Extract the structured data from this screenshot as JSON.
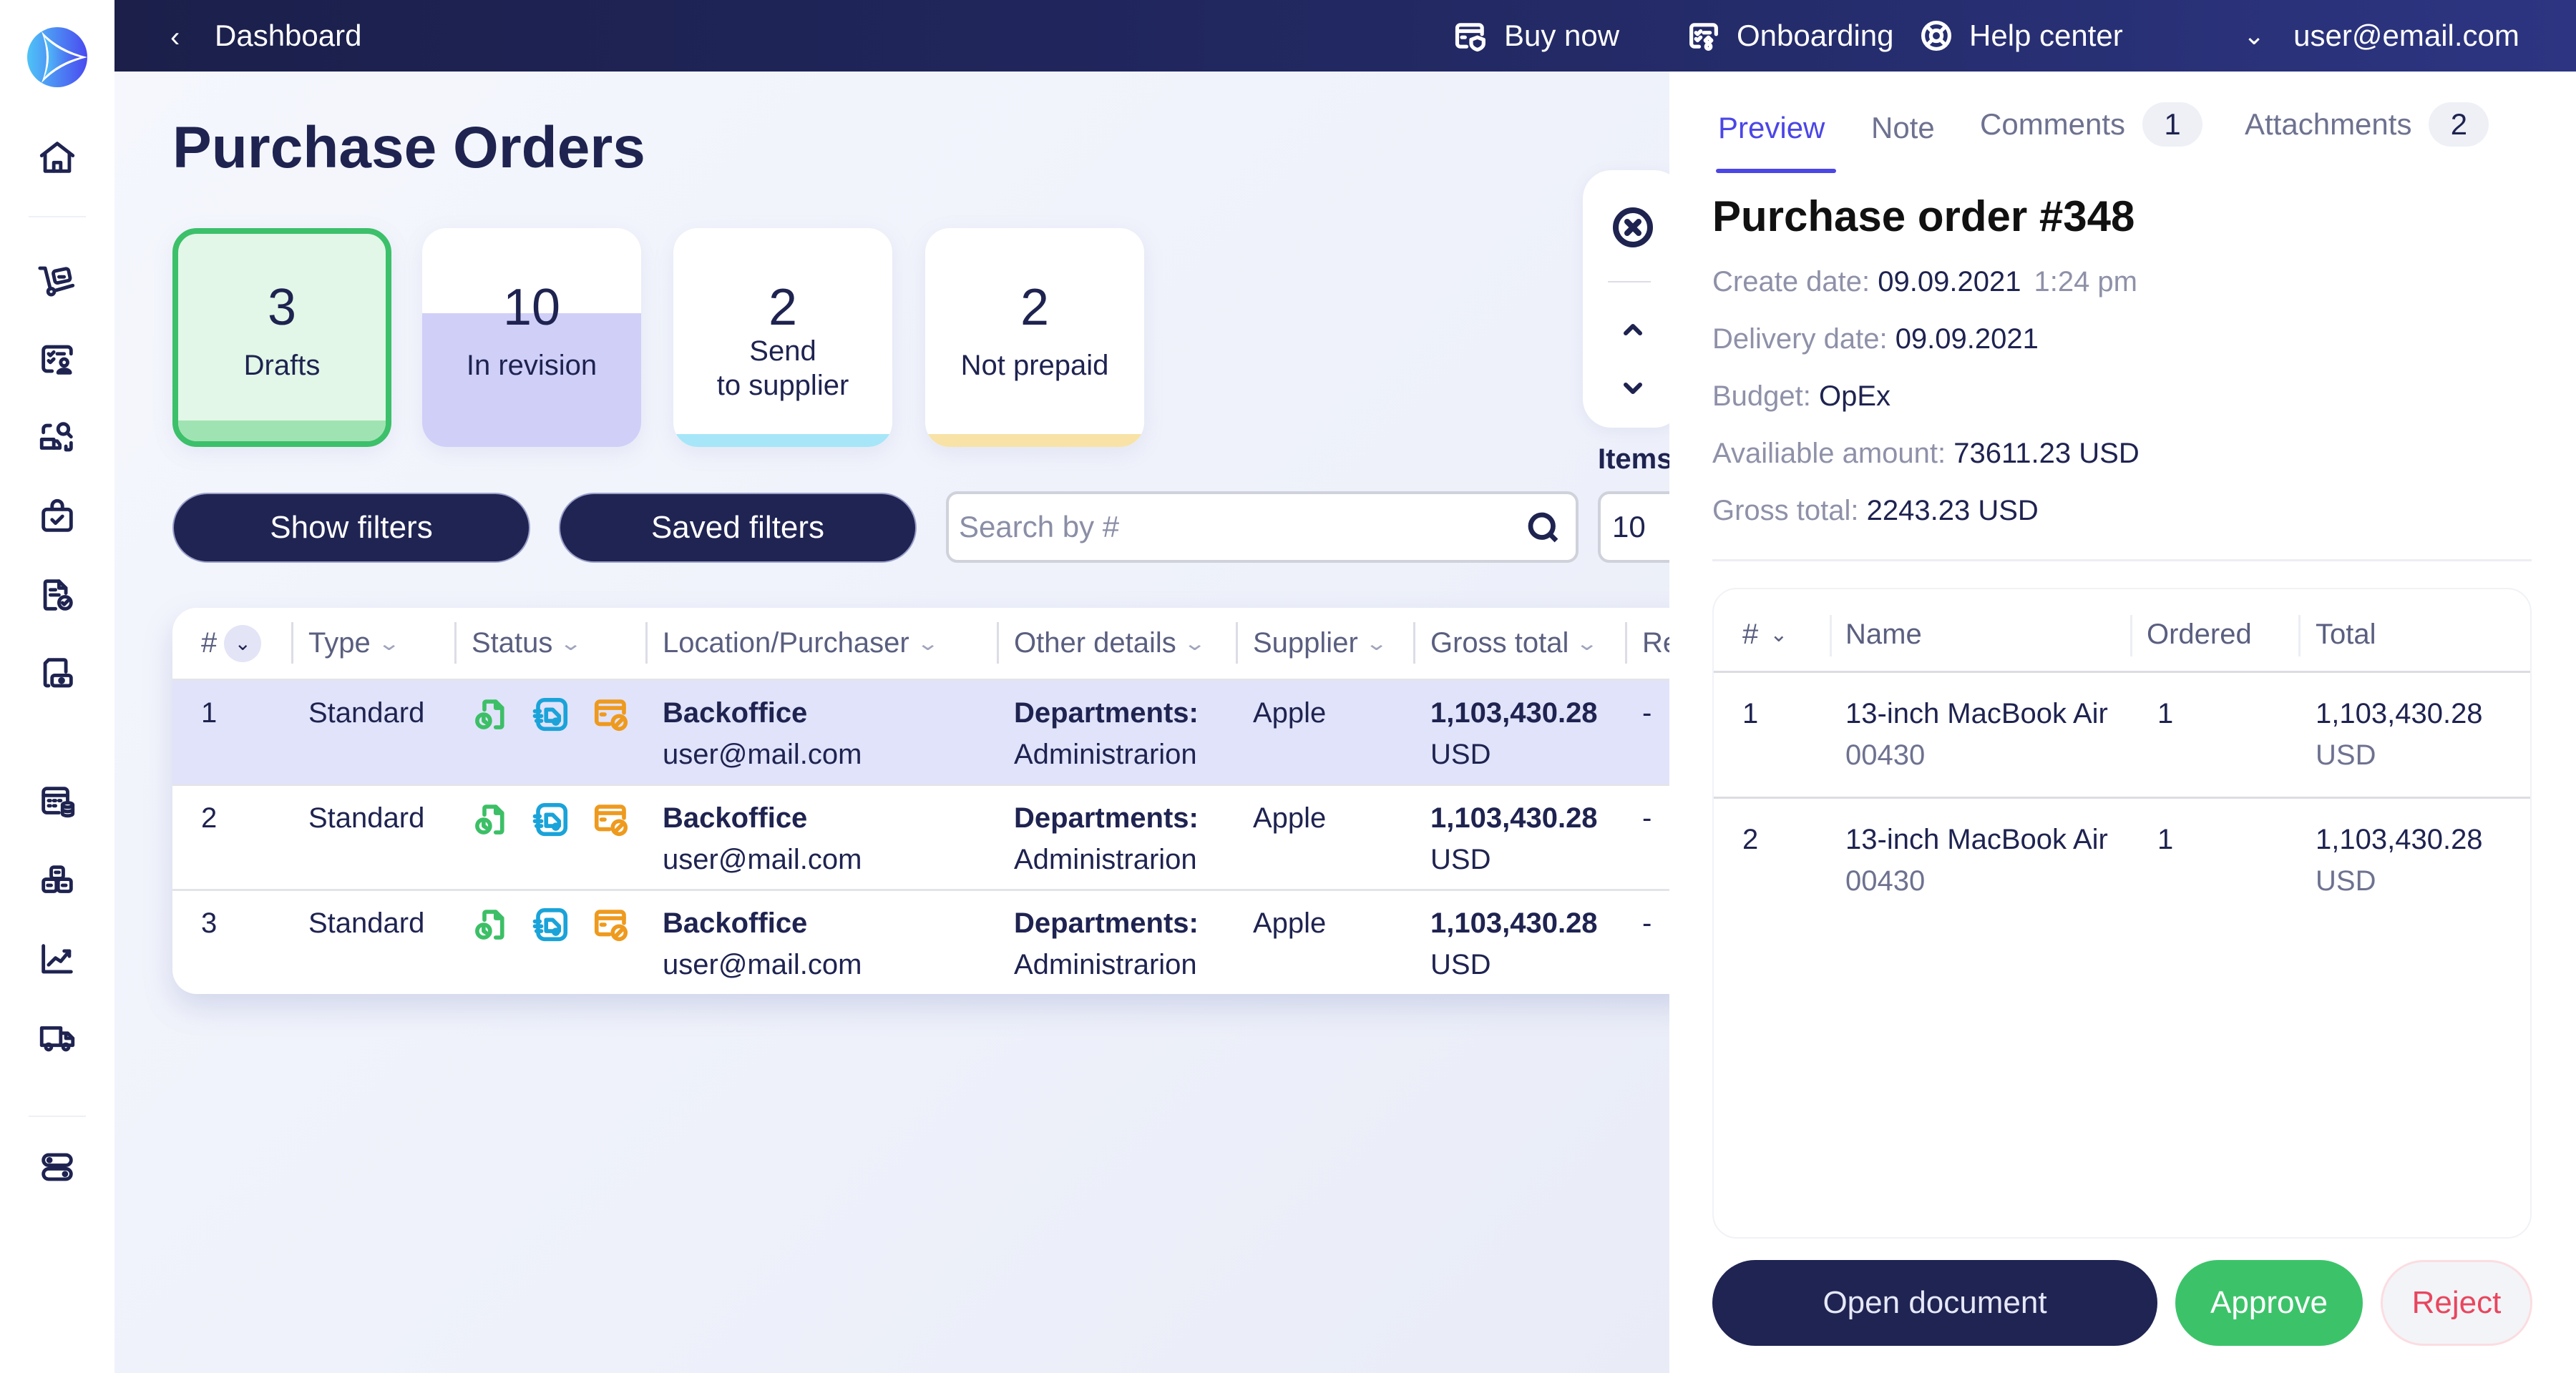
{
  "topbar": {
    "back_label": "Dashboard",
    "links": [
      {
        "label": "Buy now",
        "icon": "card-shield-icon"
      },
      {
        "label": "Onboarding",
        "icon": "onboarding-icon"
      },
      {
        "label": "Help center",
        "icon": "lifebuoy-icon"
      }
    ],
    "user": "user@email.com"
  },
  "sidebar": {
    "items": [
      {
        "name": "home",
        "icon": "home-icon"
      },
      {
        "name": "purchase-cart",
        "icon": "trolley-icon"
      },
      {
        "name": "approvals",
        "icon": "checklist-user-icon"
      },
      {
        "name": "delivery-search",
        "icon": "truck-search-icon"
      },
      {
        "name": "tasks",
        "icon": "briefcase-check-icon"
      },
      {
        "name": "documents",
        "icon": "document-check-icon"
      },
      {
        "name": "payments",
        "icon": "folder-money-icon"
      },
      {
        "name": "budget",
        "icon": "calendar-coins-icon"
      },
      {
        "name": "inventory",
        "icon": "boxes-icon"
      },
      {
        "name": "analytics",
        "icon": "chart-line-icon"
      },
      {
        "name": "shipping",
        "icon": "truck-icon"
      },
      {
        "name": "settings",
        "icon": "toggles-icon"
      }
    ]
  },
  "main": {
    "title": "Purchase Orders",
    "cards": [
      {
        "count": "3",
        "label": "Drafts",
        "color": "#a0e3b2",
        "fill": 0.1,
        "selected": true
      },
      {
        "count": "10",
        "label": "In revision",
        "color": "#d0cff8",
        "fill": 0.61,
        "selected": false
      },
      {
        "count": "2",
        "label": "Send\nto supplier",
        "color": "#a6e6f8",
        "fill": 0.06,
        "selected": false
      },
      {
        "count": "2",
        "label": "Not prepaid",
        "color": "#f8e2a6",
        "fill": 0.06,
        "selected": false
      }
    ],
    "show_filters": "Show filters",
    "saved_filters": "Saved filters",
    "search_placeholder": "Search by #",
    "items_label": "Items",
    "items_per_page": "10",
    "table": {
      "columns": [
        "#",
        "Type",
        "Status",
        "Location/Purchaser",
        "Other details",
        "Supplier",
        "Gross total",
        "Re"
      ],
      "rows": [
        {
          "num": "1",
          "type": "Standard",
          "location": "Backoffice",
          "purchaser": "user@mail.com",
          "details_label": "Departments:",
          "details_value": "Administrarion",
          "supplier": "Apple",
          "gross": "1,103,430.28",
          "currency": "USD",
          "re": "-",
          "active": true
        },
        {
          "num": "2",
          "type": "Standard",
          "location": "Backoffice",
          "purchaser": "user@mail.com",
          "details_label": "Departments:",
          "details_value": "Administrarion",
          "supplier": "Apple",
          "gross": "1,103,430.28",
          "currency": "USD",
          "re": "-",
          "active": false
        },
        {
          "num": "3",
          "type": "Standard",
          "location": "Backoffice",
          "purchaser": "user@mail.com",
          "details_label": "Departments:",
          "details_value": "Administrarion",
          "supplier": "Apple",
          "gross": "1,103,430.28",
          "currency": "USD",
          "re": "-",
          "active": false
        }
      ],
      "status_colors": {
        "document": "#3cbf66",
        "delivery": "#1aa3d9",
        "payment": "#ee9a1e"
      }
    }
  },
  "panel": {
    "tabs": [
      {
        "label": "Preview",
        "active": true
      },
      {
        "label": "Note"
      },
      {
        "label": "Comments",
        "badge": "1"
      },
      {
        "label": "Attachments",
        "badge": "2"
      }
    ],
    "title": "Purchase order #348",
    "meta": {
      "create_label": "Create date:",
      "create_value": "09.09.2021",
      "create_time": "1:24 pm",
      "delivery_label": "Delivery date:",
      "delivery_value": "09.09.2021",
      "budget_label": "Budget:",
      "budget_value": "OpEx",
      "available_label": "Availiable amount:",
      "available_value": "73611.23 USD",
      "gross_label": "Gross total:",
      "gross_value": "2243.23 USD"
    },
    "items_table": {
      "columns": [
        "#",
        "Name",
        "Ordered",
        "Total"
      ],
      "rows": [
        {
          "num": "1",
          "name": "13-inch MacBook Air",
          "code": "00430",
          "ordered": "1",
          "total": "1,103,430.28",
          "currency": "USD"
        },
        {
          "num": "2",
          "name": "13-inch MacBook Air",
          "code": "00430",
          "ordered": "1",
          "total": "1,103,430.28",
          "currency": "USD"
        }
      ]
    },
    "buttons": {
      "open": "Open document",
      "approve": "Approve",
      "reject": "Reject"
    }
  }
}
